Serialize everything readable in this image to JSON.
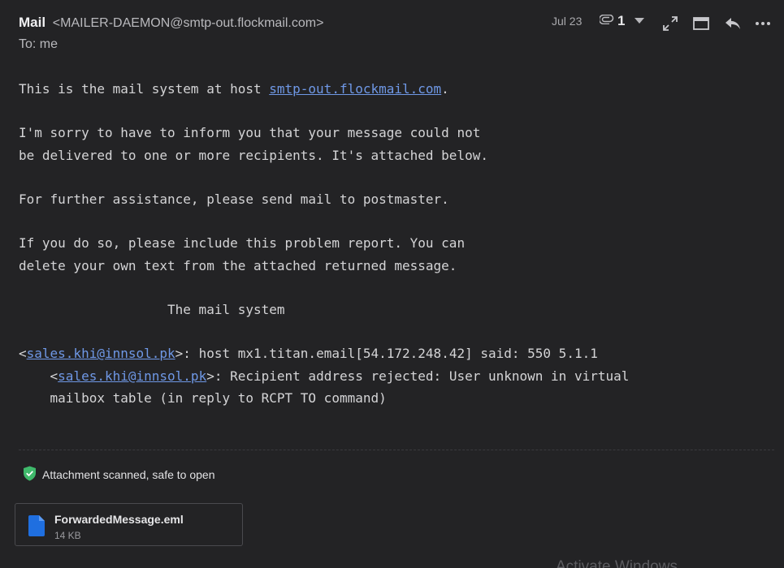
{
  "header": {
    "sender_name": "Mail",
    "sender_address": "<MAILER-DAEMON@smtp-out.flockmail.com>",
    "to_line": "To: me",
    "date": "Jul 23",
    "attachment_count": "1"
  },
  "body": {
    "line1_prefix": "This is the mail system at host ",
    "line1_link": "smtp-out.flockmail.com",
    "line1_suffix": ".",
    "line2": "I'm sorry to have to inform you that your message could not",
    "line3": "be delivered to one or more recipients. It's attached below.",
    "line4": "For further assistance, please send mail to postmaster.",
    "line5": "If you do so, please include this problem report. You can",
    "line6": "delete your own text from the attached returned message.",
    "line7": "                   The mail system",
    "line8_open": "<",
    "line8_link": "sales.khi@innsol.pk",
    "line8_rest": ">: host mx1.titan.email[54.172.248.42] said: 550 5.1.1",
    "line9_open": "    <",
    "line9_link": "sales.khi@innsol.pk",
    "line9_rest": ">: Recipient address rejected: User unknown in virtual",
    "line10": "    mailbox table (in reply to RCPT TO command)"
  },
  "attachment": {
    "scan_status": "Attachment scanned, safe to open",
    "file_name": "ForwardedMessage.eml",
    "file_size": "14 KB"
  },
  "overlay": {
    "watermark": "Activate Windows"
  },
  "colors": {
    "background": "#232325",
    "link": "#6f98e6",
    "safe_shield": "#3fb96b",
    "file_icon": "#1f6fe0"
  },
  "icons": {
    "attachment": "paperclip-icon",
    "dropdown": "chevron-down-icon",
    "expand": "expand-icon",
    "popout": "window-icon",
    "reply": "reply-icon",
    "more": "more-horizontal-icon",
    "shield": "shield-check-icon",
    "file": "file-icon"
  }
}
